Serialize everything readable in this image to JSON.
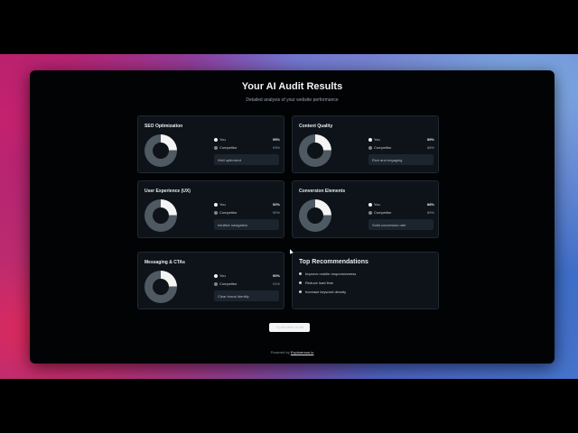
{
  "app": {
    "title": "Your AI Audit Results",
    "subtitle": "Detailed analysis of your website performance"
  },
  "cards": [
    {
      "title": "SEO Optimization",
      "you_label": "You",
      "you_value": "95%",
      "competitor_label": "Competitor",
      "competitor_value": "93%",
      "note": "Well optimized",
      "score": 0.95
    },
    {
      "title": "Content Quality",
      "you_label": "You",
      "you_value": "89%",
      "competitor_label": "Competitor",
      "competitor_value": "88%",
      "note": "Rich and engaging",
      "score": 0.89
    },
    {
      "title": "User Experience (UX)",
      "you_label": "You",
      "you_value": "92%",
      "competitor_label": "Competitor",
      "competitor_value": "90%",
      "note": "Intuitive navigation",
      "score": 0.92
    },
    {
      "title": "Conversion Elements",
      "you_label": "You",
      "you_value": "88%",
      "competitor_label": "Competitor",
      "competitor_value": "89%",
      "note": "Solid conversion rate",
      "score": 0.88
    },
    {
      "title": "Messaging & CTAs",
      "you_label": "You",
      "you_value": "90%",
      "competitor_label": "Competitor",
      "competitor_value": "91%",
      "note": "Clear brand identity",
      "score": 0.9
    }
  ],
  "recommendations": {
    "title": "Top Recommendations",
    "items": [
      "Improve mobile responsiveness",
      "Reduce load time",
      "Increase keyword density"
    ]
  },
  "actions": {
    "restart_label": "Try Another Audit"
  },
  "footer": {
    "prefix": "Powered by",
    "link_text": "Explorersun.io"
  },
  "colors": {
    "donut_primary": "#f4f4f4",
    "donut_secondary": "#4f5962",
    "card_bg": "#0d1318"
  }
}
